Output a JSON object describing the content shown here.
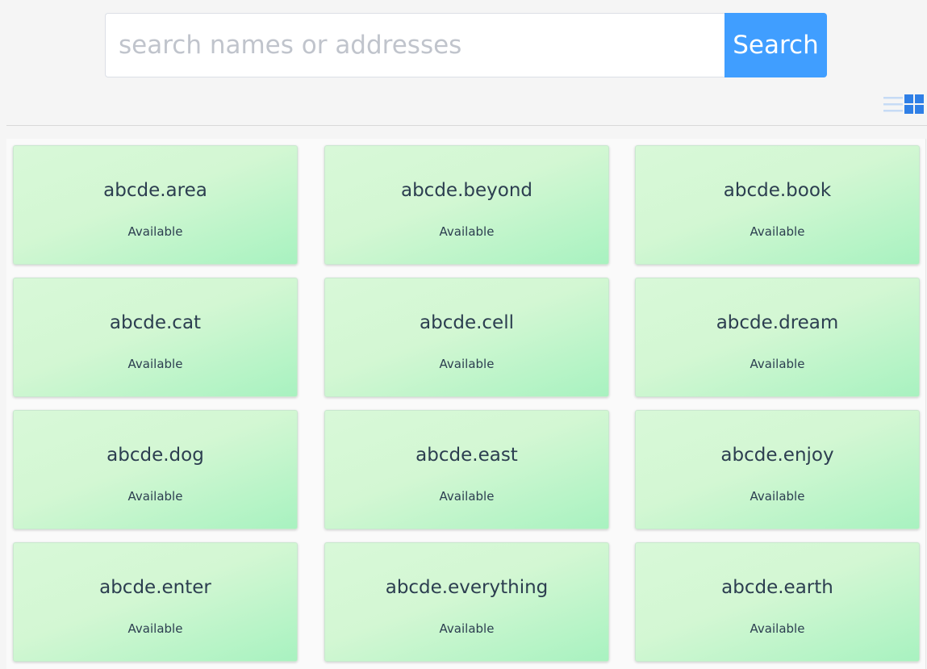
{
  "search": {
    "placeholder": "search names or addresses",
    "value": "",
    "button_label": "Search"
  },
  "view_toggle": {
    "list_icon": "list-icon",
    "grid_icon": "grid-icon",
    "active": "grid",
    "active_color": "#409eff",
    "inactive_color": "#c6dbf5"
  },
  "results": [
    {
      "name": "abcde.area",
      "status": "Available"
    },
    {
      "name": "abcde.beyond",
      "status": "Available"
    },
    {
      "name": "abcde.book",
      "status": "Available"
    },
    {
      "name": "abcde.cat",
      "status": "Available"
    },
    {
      "name": "abcde.cell",
      "status": "Available"
    },
    {
      "name": "abcde.dream",
      "status": "Available"
    },
    {
      "name": "abcde.dog",
      "status": "Available"
    },
    {
      "name": "abcde.east",
      "status": "Available"
    },
    {
      "name": "abcde.enjoy",
      "status": "Available"
    },
    {
      "name": "abcde.enter",
      "status": "Available"
    },
    {
      "name": "abcde.everything",
      "status": "Available"
    },
    {
      "name": "abcde.earth",
      "status": "Available"
    }
  ]
}
